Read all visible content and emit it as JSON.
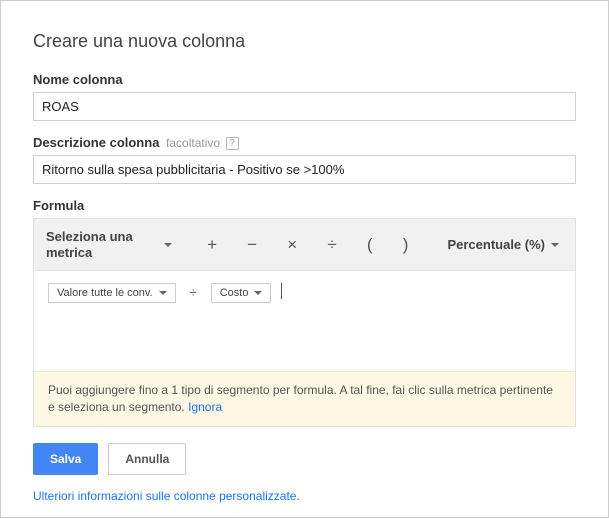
{
  "dialog": {
    "title": "Creare una nuova colonna",
    "name": {
      "label": "Nome colonna",
      "value": "ROAS"
    },
    "description": {
      "label": "Descrizione colonna",
      "optional": "facoltativo",
      "value": "Ritorno sulla spesa pubblicitaria - Positivo se >100%"
    },
    "formula": {
      "label": "Formula",
      "metric_selector": "Seleziona una metrica",
      "ops": {
        "plus": "+",
        "minus": "−",
        "times": "×",
        "divide": "÷",
        "lparen": "(",
        "rparen": ")"
      },
      "format": "Percentuale (%)",
      "chips": {
        "chip1": "Valore tutte le conv.",
        "op": "÷",
        "chip2": "Costo"
      },
      "hint": "Puoi aggiungere fino a 1 tipo di segmento per formula. A tal fine, fai clic sulla metrica pertinente e seleziona un segmento.",
      "hint_dismiss": "Ignora"
    },
    "actions": {
      "save": "Salva",
      "cancel": "Annulla"
    },
    "more_link": "Ulteriori informazioni sulle colonne personalizzate."
  }
}
